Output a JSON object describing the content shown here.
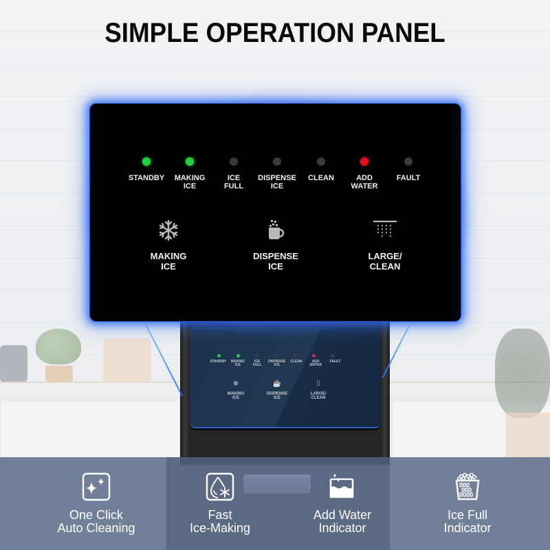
{
  "title": "SIMPLE OPERATION PANEL",
  "colors": {
    "led_green": "#22d13f",
    "led_red": "#e3121c",
    "led_off": "#3a3a3c",
    "panel_glow": "#2864ff",
    "panel_bg": "#000000"
  },
  "indicators": [
    {
      "label": "STANDBY",
      "state": "on",
      "color": "green"
    },
    {
      "label": "MAKING\nICE",
      "state": "on",
      "color": "green"
    },
    {
      "label": "ICE\nFULL",
      "state": "off",
      "color": "off"
    },
    {
      "label": "DISPENSE\nICE",
      "state": "off",
      "color": "off"
    },
    {
      "label": "CLEAN",
      "state": "off",
      "color": "off"
    },
    {
      "label": "ADD\nWATER",
      "state": "on",
      "color": "red"
    },
    {
      "label": "FAULT",
      "state": "off",
      "color": "off"
    }
  ],
  "buttons": [
    {
      "label": "MAKING\nICE",
      "icon": "snowflake-icon"
    },
    {
      "label": "DISPENSE\nICE",
      "icon": "ice-cup-icon"
    },
    {
      "label": "LARGE/\nCLEAN",
      "icon": "shower-clean-icon"
    }
  ],
  "mini_panel": {
    "indicators": [
      "STANDBY",
      "MAKING\nICE",
      "ICE\nFULL",
      "DISPENSE\nICE",
      "CLEAN",
      "ADD\nWATER",
      "FAULT"
    ],
    "buttons": [
      "MAKING\nICE",
      "DISPENSE\nICE",
      "LARGE/\nCLEAN"
    ]
  },
  "features": [
    {
      "label": "One Click\nAuto Cleaning",
      "icon": "sparkle-icon"
    },
    {
      "label": "Fast\nIce-Making",
      "icon": "water-drop-snowflake-icon"
    },
    {
      "label": "Add Water\nIndicator",
      "icon": "water-tank-icon"
    },
    {
      "label": "Ice Full\nIndicator",
      "icon": "ice-bucket-icon"
    }
  ]
}
